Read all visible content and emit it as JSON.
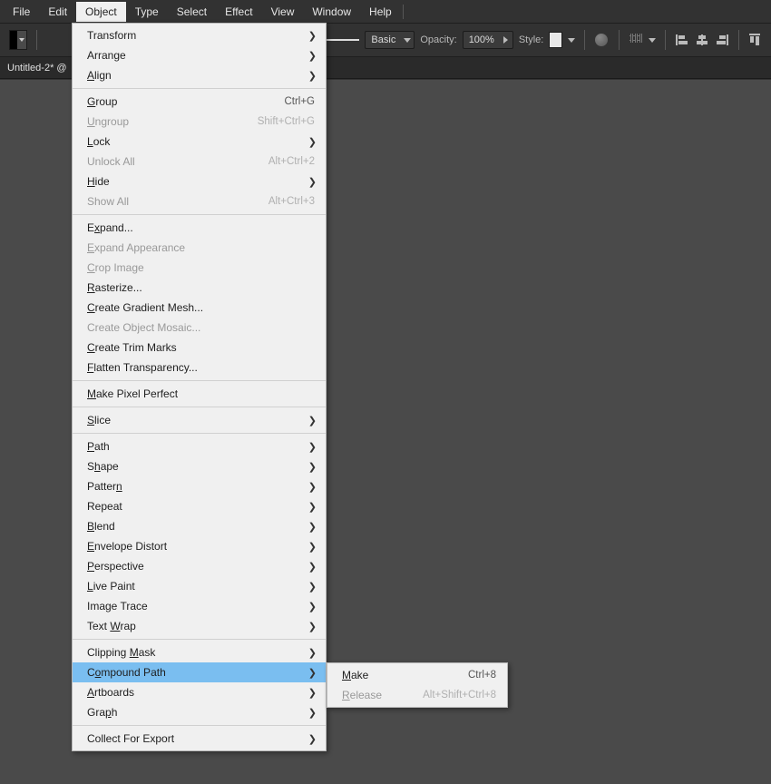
{
  "menubar": {
    "items": [
      "File",
      "Edit",
      "Object",
      "Type",
      "Select",
      "Effect",
      "View",
      "Window",
      "Help"
    ],
    "active_index": 2
  },
  "optionsbar": {
    "stroke_style_label": "Basic",
    "opacity_label": "Opacity:",
    "opacity_value": "100%",
    "style_label": "Style:"
  },
  "document": {
    "tab_label": "Untitled-2* @"
  },
  "object_menu": {
    "groups": [
      [
        {
          "label": "Transform",
          "submenu": true
        },
        {
          "label": "Arrange",
          "submenu": true
        },
        {
          "label": "Align",
          "mn": 0,
          "submenu": true
        }
      ],
      [
        {
          "label": "Group",
          "mn": 0,
          "shortcut": "Ctrl+G"
        },
        {
          "label": "Ungroup",
          "mn": 0,
          "shortcut": "Shift+Ctrl+G",
          "disabled": true
        },
        {
          "label": "Lock",
          "mn": 0,
          "submenu": true
        },
        {
          "label": "Unlock All",
          "shortcut": "Alt+Ctrl+2",
          "disabled": true
        },
        {
          "label": "Hide",
          "mn": 0,
          "submenu": true
        },
        {
          "label": "Show All",
          "shortcut": "Alt+Ctrl+3",
          "disabled": true
        }
      ],
      [
        {
          "label": "Expand...",
          "mn": 1
        },
        {
          "label": "Expand Appearance",
          "mn": 0,
          "disabled": true
        },
        {
          "label": "Crop Image",
          "mn": 0,
          "disabled": true
        },
        {
          "label": "Rasterize...",
          "mn": 0
        },
        {
          "label": "Create Gradient Mesh...",
          "mn": 0
        },
        {
          "label": "Create Object Mosaic...",
          "disabled": true
        },
        {
          "label": "Create Trim Marks",
          "mn": 0
        },
        {
          "label": "Flatten Transparency...",
          "mn": 0
        }
      ],
      [
        {
          "label": "Make Pixel Perfect",
          "mn": 0
        }
      ],
      [
        {
          "label": "Slice",
          "mn": 0,
          "submenu": true
        }
      ],
      [
        {
          "label": "Path",
          "mn": 0,
          "submenu": true
        },
        {
          "label": "Shape",
          "mn": 1,
          "submenu": true
        },
        {
          "label": "Pattern",
          "mn": 6,
          "submenu": true
        },
        {
          "label": "Repeat",
          "submenu": true
        },
        {
          "label": "Blend",
          "mn": 0,
          "submenu": true
        },
        {
          "label": "Envelope Distort",
          "mn": 0,
          "submenu": true
        },
        {
          "label": "Perspective",
          "mn": 0,
          "submenu": true
        },
        {
          "label": "Live Paint",
          "mn": 0,
          "submenu": true
        },
        {
          "label": "Image Trace",
          "submenu": true
        },
        {
          "label": "Text Wrap",
          "mn": 5,
          "submenu": true
        }
      ],
      [
        {
          "label": "Clipping Mask",
          "mn": 9,
          "submenu": true
        },
        {
          "label": "Compound Path",
          "mn": 1,
          "submenu": true,
          "highlight": true
        },
        {
          "label": "Artboards",
          "mn": 0,
          "submenu": true
        },
        {
          "label": "Graph",
          "mn": 3,
          "submenu": true
        }
      ],
      [
        {
          "label": "Collect For Export",
          "submenu": true
        }
      ]
    ]
  },
  "compound_path_submenu": {
    "items": [
      {
        "label": "Make",
        "mn": 0,
        "shortcut": "Ctrl+8",
        "highlight": true
      },
      {
        "label": "Release",
        "mn": 0,
        "shortcut": "Alt+Shift+Ctrl+8",
        "disabled": true
      }
    ]
  }
}
